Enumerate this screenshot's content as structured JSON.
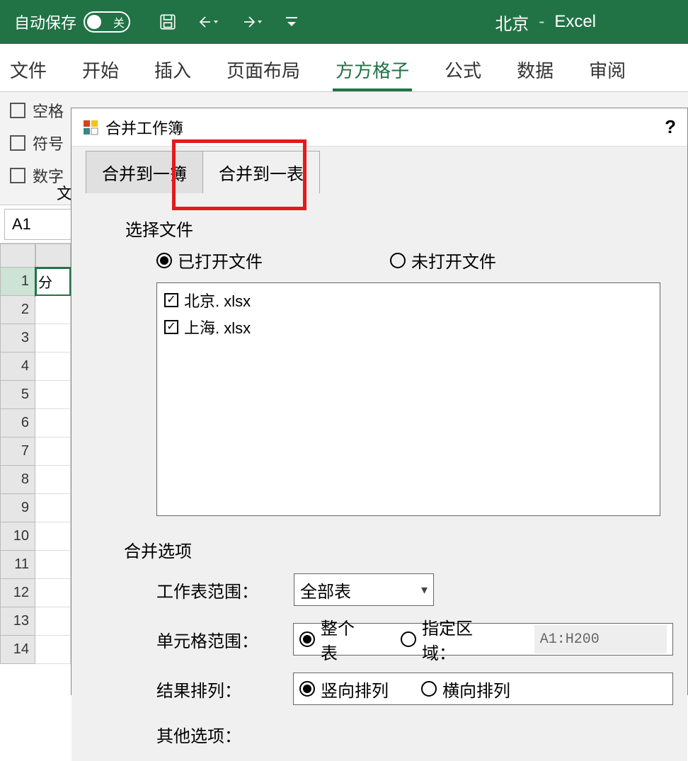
{
  "titlebar": {
    "autosave_label": "自动保存",
    "autosave_off": "关",
    "doc_name": "北京",
    "dash": "-",
    "app_name": "Excel"
  },
  "ribbon": {
    "tabs": [
      "文件",
      "开始",
      "插入",
      "页面布局",
      "方方格子",
      "公式",
      "数据",
      "审阅"
    ],
    "active_index": 4
  },
  "ribbon_body": {
    "chk1": "空格",
    "chk2": "符号",
    "chk3": "数字",
    "wen": "文"
  },
  "namebox": {
    "ref": "A1"
  },
  "grid": {
    "row_headers": [
      "1",
      "2",
      "3",
      "4",
      "5",
      "6",
      "7",
      "8",
      "9",
      "10",
      "11",
      "12",
      "13",
      "14"
    ],
    "cell_a1": "分"
  },
  "dialog": {
    "title": "合并工作簿",
    "help": "?",
    "tabs": {
      "t1": "合并到一簿",
      "t2": "合并到一表"
    },
    "section_select_file": "选择文件",
    "radio_opened": "已打开文件",
    "radio_unopened": "未打开文件",
    "files": [
      {
        "name": "北京. xlsx",
        "checked": true
      },
      {
        "name": "上海. xlsx",
        "checked": true
      }
    ],
    "section_merge_opts": "合并选项",
    "row_sheet_range": {
      "label": "工作表范围：",
      "value": "全部表"
    },
    "row_cell_range": {
      "label": "单元格范围：",
      "r1": "整个表",
      "r2": "指定区域：",
      "range_value": "A1:H200"
    },
    "row_result_arrange": {
      "label": "结果排列：",
      "r1": "竖向排列",
      "r2": "横向排列"
    },
    "row_other": {
      "label": "其他选项："
    }
  }
}
